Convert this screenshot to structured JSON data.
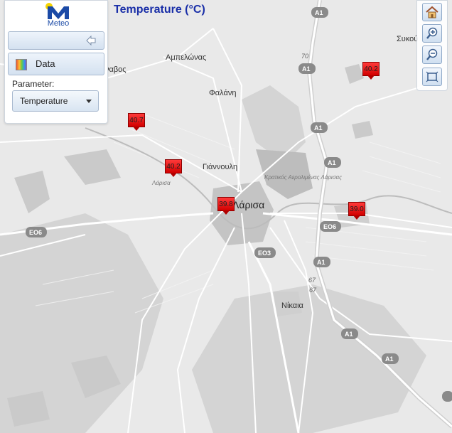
{
  "title": "Temperature (°C)",
  "panel": {
    "logo_text": "Meteo",
    "data_label": "Data",
    "parameter_label": "Parameter:",
    "parameter_value": "Temperature",
    "icons": [
      "collapse-arrow-icon",
      "data-layers-icon",
      "chevron-down-icon"
    ]
  },
  "toolbar": {
    "buttons": [
      "home-icon",
      "zoom-in-icon",
      "zoom-out-icon",
      "zoom-extent-icon"
    ]
  },
  "stations": [
    {
      "value": "40.7",
      "unit": "°C"
    },
    {
      "value": "40.2",
      "unit": "°C"
    },
    {
      "value": "39.8",
      "unit": "°C"
    },
    {
      "value": "40.2",
      "unit": "°C"
    },
    {
      "value": "39.0",
      "unit": "°C"
    }
  ],
  "places": {
    "ampelonas": "Αμπελώνας",
    "falani": "Φαλάνη",
    "giannouli": "Γιάννουλη",
    "larisa": "Λάρισα",
    "nikaia": "Νίκαια",
    "sykourio": "Συκού",
    "tyrnavos": "ναβος",
    "larisa_airport": "Κρατικός Αερολιμένας Λάρισας",
    "larisa_region": "Λάρισα"
  },
  "roads": {
    "a1": "A1",
    "eo6": "EO6",
    "eo3": "EO3",
    "km70": "70",
    "km67a": "67",
    "km67b": "67"
  },
  "colors": {
    "marker": "#e00000",
    "title": "#1a2fa8",
    "map_background": "#e9e9e9"
  }
}
